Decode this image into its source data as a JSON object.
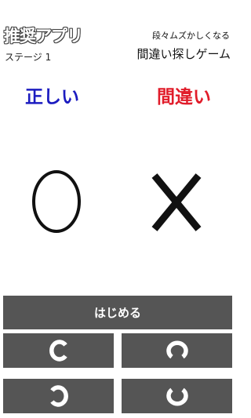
{
  "header": {
    "logo_text": "推奨アプリ",
    "stage_label": "ステージ 1",
    "subtitle": "段々ムズかしくなる",
    "game_title": "間違い探しゲーム"
  },
  "columns": {
    "correct_label": "正しい",
    "wrong_label": "間違い"
  },
  "symbols": {
    "correct": "circle-icon",
    "wrong": "cross-icon"
  },
  "controls": {
    "start_label": "はじめる",
    "options": [
      "landolt-c-open-right",
      "landolt-c-open-bottom",
      "landolt-c-open-left",
      "landolt-c-open-top"
    ]
  },
  "colors": {
    "correct": "#1c1cc0",
    "wrong": "#e11c2a",
    "button_bg": "#555555",
    "button_fg": "#ffffff"
  }
}
